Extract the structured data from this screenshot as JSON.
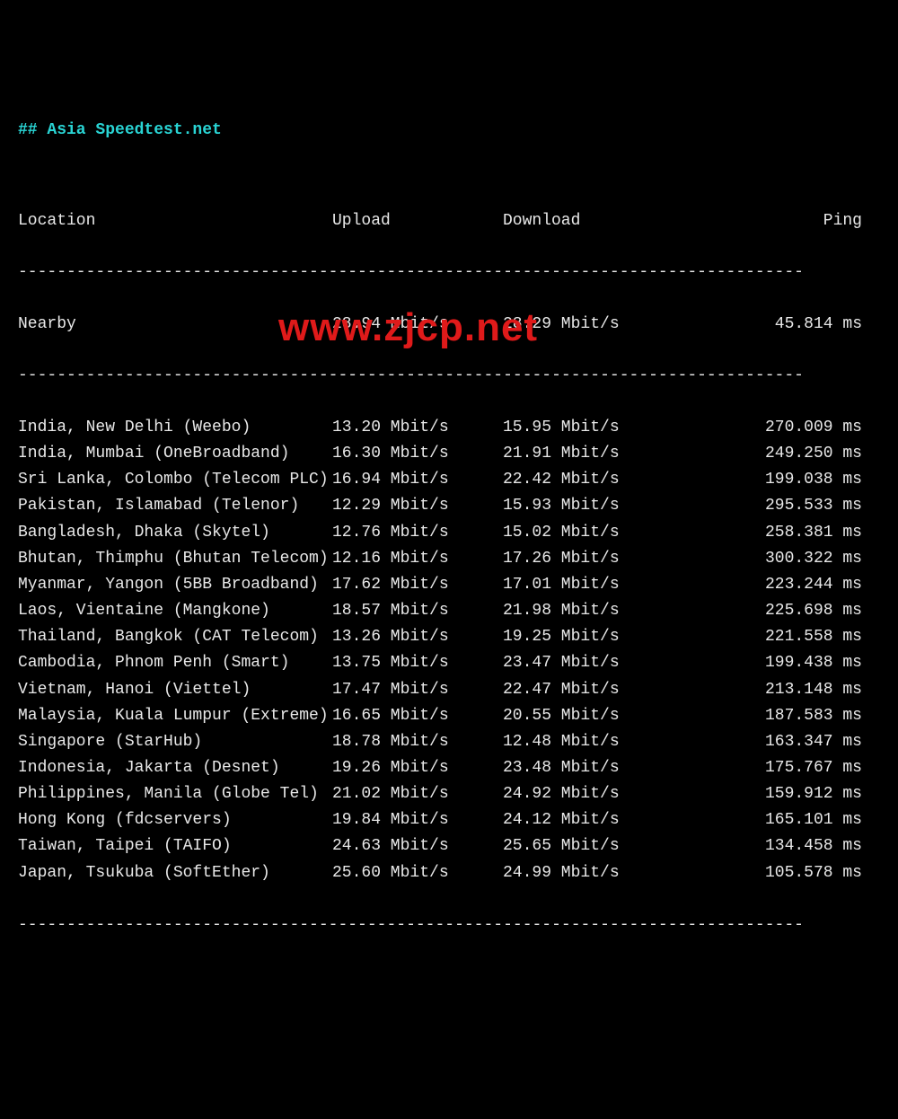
{
  "title": "## Asia Speedtest.net",
  "watermark": "www.zjcp.net",
  "columns": {
    "location": "Location",
    "upload": "Upload",
    "download": "Download",
    "ping": "Ping"
  },
  "divider": "---------------------------------------------------------------------------------",
  "nearby": {
    "location": "Nearby",
    "upload": "28.94 Mbit/s",
    "download": "28.29 Mbit/s",
    "ping": "45.814 ms"
  },
  "rows": [
    {
      "location": "India, New Delhi (Weebo)",
      "upload": "13.20 Mbit/s",
      "download": "15.95 Mbit/s",
      "ping": "270.009 ms"
    },
    {
      "location": "India, Mumbai (OneBroadband)",
      "upload": "16.30 Mbit/s",
      "download": "21.91 Mbit/s",
      "ping": "249.250 ms"
    },
    {
      "location": "Sri Lanka, Colombo (Telecom PLC)",
      "upload": "16.94 Mbit/s",
      "download": "22.42 Mbit/s",
      "ping": "199.038 ms"
    },
    {
      "location": "Pakistan, Islamabad (Telenor)",
      "upload": "12.29 Mbit/s",
      "download": "15.93 Mbit/s",
      "ping": "295.533 ms"
    },
    {
      "location": "Bangladesh, Dhaka (Skytel)",
      "upload": "12.76 Mbit/s",
      "download": "15.02 Mbit/s",
      "ping": "258.381 ms"
    },
    {
      "location": "Bhutan, Thimphu (Bhutan Telecom)",
      "upload": "12.16 Mbit/s",
      "download": "17.26 Mbit/s",
      "ping": "300.322 ms"
    },
    {
      "location": "Myanmar, Yangon (5BB Broadband)",
      "upload": "17.62 Mbit/s",
      "download": "17.01 Mbit/s",
      "ping": "223.244 ms"
    },
    {
      "location": "Laos, Vientaine (Mangkone)",
      "upload": "18.57 Mbit/s",
      "download": "21.98 Mbit/s",
      "ping": "225.698 ms"
    },
    {
      "location": "Thailand, Bangkok (CAT Telecom)",
      "upload": "13.26 Mbit/s",
      "download": "19.25 Mbit/s",
      "ping": "221.558 ms"
    },
    {
      "location": "Cambodia, Phnom Penh (Smart)",
      "upload": "13.75 Mbit/s",
      "download": "23.47 Mbit/s",
      "ping": "199.438 ms"
    },
    {
      "location": "Vietnam, Hanoi (Viettel)",
      "upload": "17.47 Mbit/s",
      "download": "22.47 Mbit/s",
      "ping": "213.148 ms"
    },
    {
      "location": "Malaysia, Kuala Lumpur (Extreme)",
      "upload": "16.65 Mbit/s",
      "download": "20.55 Mbit/s",
      "ping": "187.583 ms"
    },
    {
      "location": "Singapore (StarHub)",
      "upload": "18.78 Mbit/s",
      "download": "12.48 Mbit/s",
      "ping": "163.347 ms"
    },
    {
      "location": "Indonesia, Jakarta (Desnet)",
      "upload": "19.26 Mbit/s",
      "download": "23.48 Mbit/s",
      "ping": "175.767 ms"
    },
    {
      "location": "Philippines, Manila (Globe Tel)",
      "upload": "21.02 Mbit/s",
      "download": "24.92 Mbit/s",
      "ping": "159.912 ms"
    },
    {
      "location": "Hong Kong (fdcservers)",
      "upload": "19.84 Mbit/s",
      "download": "24.12 Mbit/s",
      "ping": "165.101 ms"
    },
    {
      "location": "Taiwan, Taipei (TAIFO)",
      "upload": "24.63 Mbit/s",
      "download": "25.65 Mbit/s",
      "ping": "134.458 ms"
    },
    {
      "location": "Japan, Tsukuba (SoftEther)",
      "upload": "25.60 Mbit/s",
      "download": "24.99 Mbit/s",
      "ping": "105.578 ms"
    }
  ]
}
